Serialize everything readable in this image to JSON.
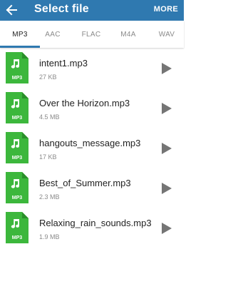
{
  "appbar": {
    "title": "Select file",
    "more_label": "MORE",
    "color": "#2f79b0"
  },
  "tabs": [
    {
      "label": "MP3",
      "active": true
    },
    {
      "label": "AAC",
      "active": false
    },
    {
      "label": "FLAC",
      "active": false
    },
    {
      "label": "M4A",
      "active": false
    },
    {
      "label": "WAV",
      "active": false
    }
  ],
  "file_icon": {
    "badge": "MP3",
    "color": "#3cb73c",
    "icon": "music-note-icon"
  },
  "files": [
    {
      "name": "intent1.mp3",
      "size": "27 KB"
    },
    {
      "name": "Over the Horizon.mp3",
      "size": "4.5 MB"
    },
    {
      "name": "hangouts_message.mp3",
      "size": "17 KB"
    },
    {
      "name": "Best_of_Summer.mp3",
      "size": "2.3 MB"
    },
    {
      "name": "Relaxing_rain_sounds.mp3",
      "size": "1.9 MB"
    }
  ]
}
